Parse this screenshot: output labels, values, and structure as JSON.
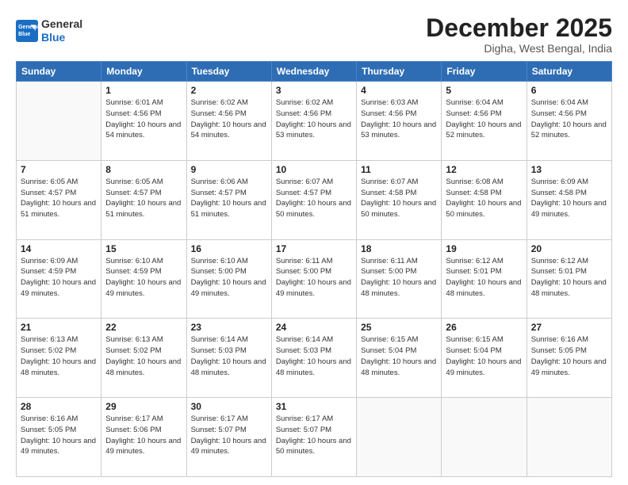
{
  "logo": {
    "general": "General",
    "blue": "Blue"
  },
  "title": "December 2025",
  "location": "Digha, West Bengal, India",
  "weekdays": [
    "Sunday",
    "Monday",
    "Tuesday",
    "Wednesday",
    "Thursday",
    "Friday",
    "Saturday"
  ],
  "weeks": [
    [
      {
        "day": "",
        "info": ""
      },
      {
        "day": "1",
        "info": "Sunrise: 6:01 AM\nSunset: 4:56 PM\nDaylight: 10 hours\nand 54 minutes."
      },
      {
        "day": "2",
        "info": "Sunrise: 6:02 AM\nSunset: 4:56 PM\nDaylight: 10 hours\nand 54 minutes."
      },
      {
        "day": "3",
        "info": "Sunrise: 6:02 AM\nSunset: 4:56 PM\nDaylight: 10 hours\nand 53 minutes."
      },
      {
        "day": "4",
        "info": "Sunrise: 6:03 AM\nSunset: 4:56 PM\nDaylight: 10 hours\nand 53 minutes."
      },
      {
        "day": "5",
        "info": "Sunrise: 6:04 AM\nSunset: 4:56 PM\nDaylight: 10 hours\nand 52 minutes."
      },
      {
        "day": "6",
        "info": "Sunrise: 6:04 AM\nSunset: 4:56 PM\nDaylight: 10 hours\nand 52 minutes."
      }
    ],
    [
      {
        "day": "7",
        "info": "Sunrise: 6:05 AM\nSunset: 4:57 PM\nDaylight: 10 hours\nand 51 minutes."
      },
      {
        "day": "8",
        "info": "Sunrise: 6:05 AM\nSunset: 4:57 PM\nDaylight: 10 hours\nand 51 minutes."
      },
      {
        "day": "9",
        "info": "Sunrise: 6:06 AM\nSunset: 4:57 PM\nDaylight: 10 hours\nand 51 minutes."
      },
      {
        "day": "10",
        "info": "Sunrise: 6:07 AM\nSunset: 4:57 PM\nDaylight: 10 hours\nand 50 minutes."
      },
      {
        "day": "11",
        "info": "Sunrise: 6:07 AM\nSunset: 4:58 PM\nDaylight: 10 hours\nand 50 minutes."
      },
      {
        "day": "12",
        "info": "Sunrise: 6:08 AM\nSunset: 4:58 PM\nDaylight: 10 hours\nand 50 minutes."
      },
      {
        "day": "13",
        "info": "Sunrise: 6:09 AM\nSunset: 4:58 PM\nDaylight: 10 hours\nand 49 minutes."
      }
    ],
    [
      {
        "day": "14",
        "info": "Sunrise: 6:09 AM\nSunset: 4:59 PM\nDaylight: 10 hours\nand 49 minutes."
      },
      {
        "day": "15",
        "info": "Sunrise: 6:10 AM\nSunset: 4:59 PM\nDaylight: 10 hours\nand 49 minutes."
      },
      {
        "day": "16",
        "info": "Sunrise: 6:10 AM\nSunset: 5:00 PM\nDaylight: 10 hours\nand 49 minutes."
      },
      {
        "day": "17",
        "info": "Sunrise: 6:11 AM\nSunset: 5:00 PM\nDaylight: 10 hours\nand 49 minutes."
      },
      {
        "day": "18",
        "info": "Sunrise: 6:11 AM\nSunset: 5:00 PM\nDaylight: 10 hours\nand 48 minutes."
      },
      {
        "day": "19",
        "info": "Sunrise: 6:12 AM\nSunset: 5:01 PM\nDaylight: 10 hours\nand 48 minutes."
      },
      {
        "day": "20",
        "info": "Sunrise: 6:12 AM\nSunset: 5:01 PM\nDaylight: 10 hours\nand 48 minutes."
      }
    ],
    [
      {
        "day": "21",
        "info": "Sunrise: 6:13 AM\nSunset: 5:02 PM\nDaylight: 10 hours\nand 48 minutes."
      },
      {
        "day": "22",
        "info": "Sunrise: 6:13 AM\nSunset: 5:02 PM\nDaylight: 10 hours\nand 48 minutes."
      },
      {
        "day": "23",
        "info": "Sunrise: 6:14 AM\nSunset: 5:03 PM\nDaylight: 10 hours\nand 48 minutes."
      },
      {
        "day": "24",
        "info": "Sunrise: 6:14 AM\nSunset: 5:03 PM\nDaylight: 10 hours\nand 48 minutes."
      },
      {
        "day": "25",
        "info": "Sunrise: 6:15 AM\nSunset: 5:04 PM\nDaylight: 10 hours\nand 48 minutes."
      },
      {
        "day": "26",
        "info": "Sunrise: 6:15 AM\nSunset: 5:04 PM\nDaylight: 10 hours\nand 49 minutes."
      },
      {
        "day": "27",
        "info": "Sunrise: 6:16 AM\nSunset: 5:05 PM\nDaylight: 10 hours\nand 49 minutes."
      }
    ],
    [
      {
        "day": "28",
        "info": "Sunrise: 6:16 AM\nSunset: 5:05 PM\nDaylight: 10 hours\nand 49 minutes."
      },
      {
        "day": "29",
        "info": "Sunrise: 6:17 AM\nSunset: 5:06 PM\nDaylight: 10 hours\nand 49 minutes."
      },
      {
        "day": "30",
        "info": "Sunrise: 6:17 AM\nSunset: 5:07 PM\nDaylight: 10 hours\nand 49 minutes."
      },
      {
        "day": "31",
        "info": "Sunrise: 6:17 AM\nSunset: 5:07 PM\nDaylight: 10 hours\nand 50 minutes."
      },
      {
        "day": "",
        "info": ""
      },
      {
        "day": "",
        "info": ""
      },
      {
        "day": "",
        "info": ""
      }
    ]
  ]
}
